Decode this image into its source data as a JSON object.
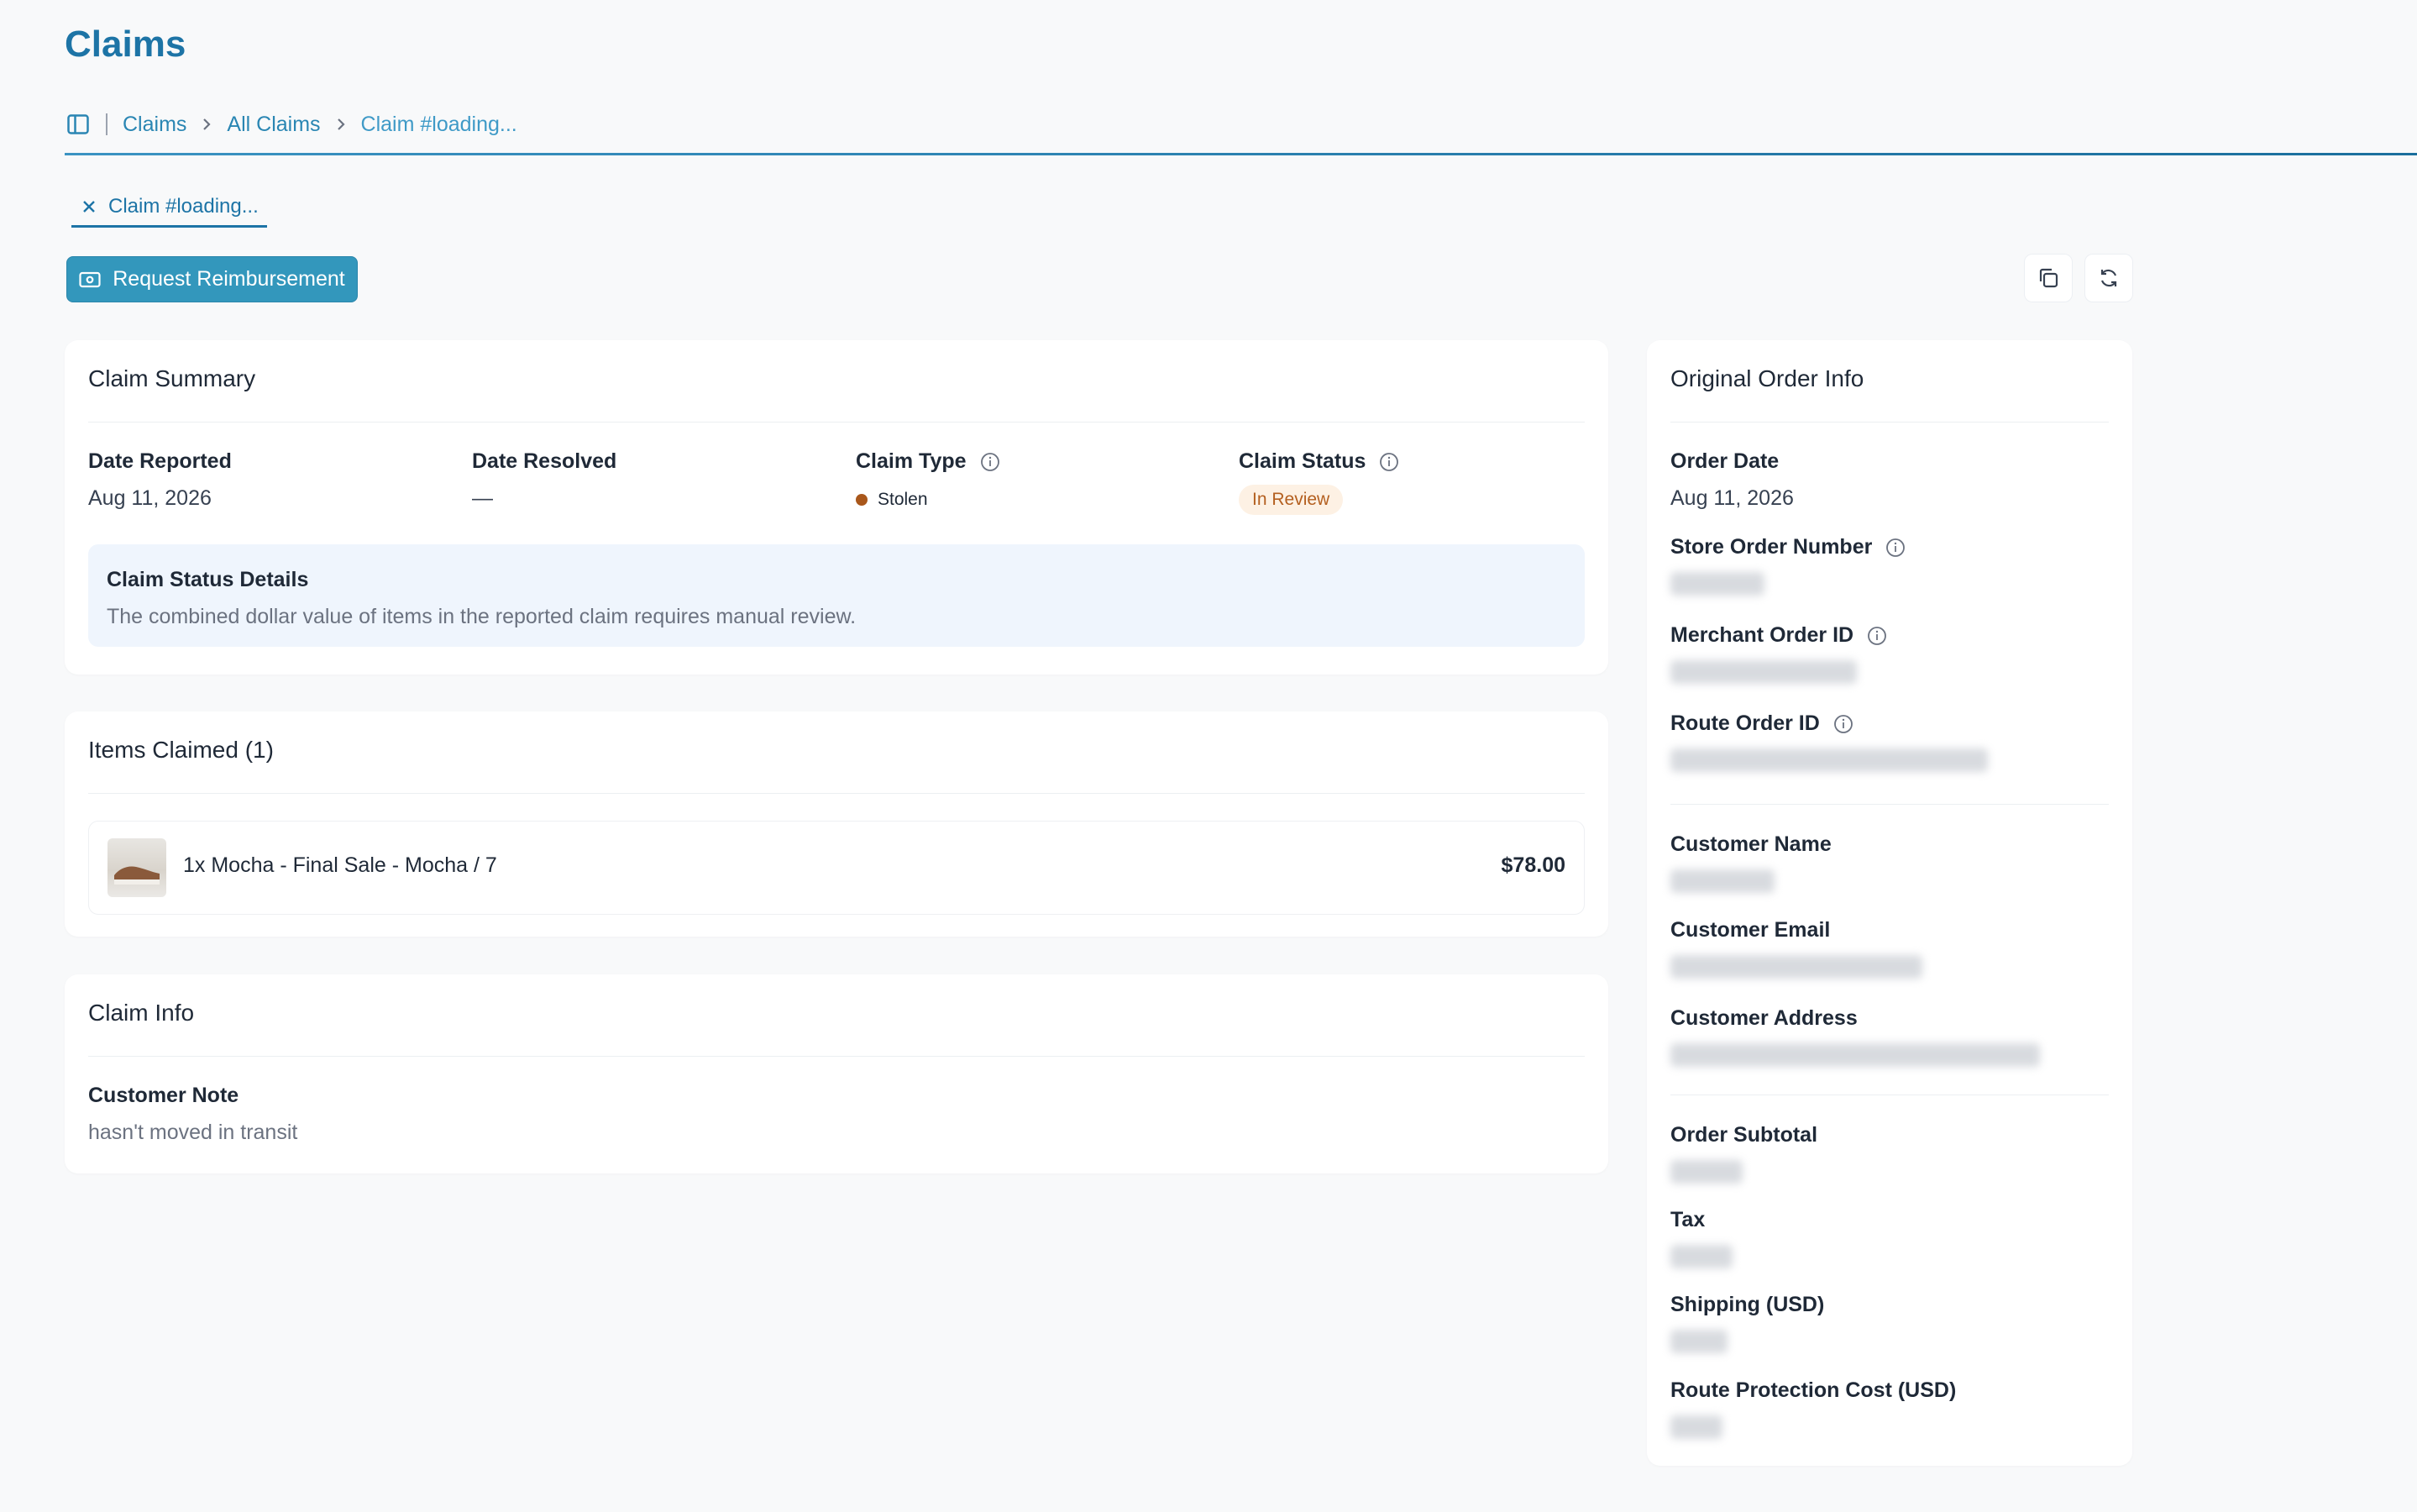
{
  "page": {
    "title": "Claims"
  },
  "breadcrumb": {
    "items": [
      "Claims",
      "All Claims",
      "Claim #loading..."
    ]
  },
  "tab": {
    "label": "Claim #loading..."
  },
  "actions": {
    "reimburse_label": "Request Reimbursement"
  },
  "summary": {
    "title": "Claim Summary",
    "date_reported_label": "Date Reported",
    "date_reported": "Aug 11, 2026",
    "date_resolved_label": "Date Resolved",
    "date_resolved": "—",
    "claim_type_label": "Claim Type",
    "claim_type": "Stolen",
    "claim_status_label": "Claim Status",
    "claim_status": "In Review",
    "details_title": "Claim Status Details",
    "details_text": "The combined dollar value of items in the reported claim requires manual review."
  },
  "items": {
    "title": "Items Claimed (1)",
    "list": [
      {
        "name": "1x Mocha - Final Sale - Mocha / 7",
        "price": "$78.00"
      }
    ]
  },
  "claim_info": {
    "title": "Claim Info",
    "note_label": "Customer Note",
    "note": "hasn't moved in transit"
  },
  "order": {
    "title": "Original Order Info",
    "order_date_label": "Order Date",
    "order_date": "Aug 11, 2026",
    "store_order_label": "Store Order Number",
    "merchant_order_label": "Merchant Order ID",
    "route_order_label": "Route Order ID",
    "customer_name_label": "Customer Name",
    "customer_email_label": "Customer Email",
    "customer_address_label": "Customer Address",
    "subtotal_label": "Order Subtotal",
    "tax_label": "Tax",
    "shipping_label": "Shipping (USD)",
    "protection_label": "Route Protection Cost (USD)"
  },
  "colors": {
    "accent": "#1d74a6",
    "button": "#3397bc",
    "status_bg": "#fdf1e4",
    "status_text": "#b45f1f"
  }
}
